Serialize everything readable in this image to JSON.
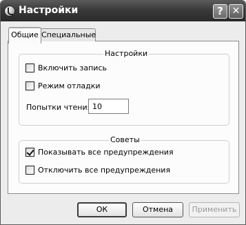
{
  "window": {
    "title": "Настройки",
    "help_label": "?",
    "close_label": "✕"
  },
  "tabs": [
    {
      "label": "Общие",
      "active": true
    },
    {
      "label": "Специальные",
      "active": false
    }
  ],
  "settings_group": {
    "title": "Настройки",
    "enable_logging": {
      "label": "Включить запись",
      "checked": false
    },
    "debug_mode": {
      "label": "Режим отладки",
      "checked": false
    },
    "read_attempts": {
      "label": "Попытки чтения",
      "value": "10"
    }
  },
  "tips_group": {
    "title": "Советы",
    "show_warnings": {
      "label": "Показывать все предупреждения",
      "checked": true
    },
    "disable_warnings": {
      "label": "Отключить все предупреждения",
      "checked": false
    }
  },
  "buttons": {
    "ok": "ОК",
    "cancel": "Отмена",
    "apply": "Применить"
  }
}
